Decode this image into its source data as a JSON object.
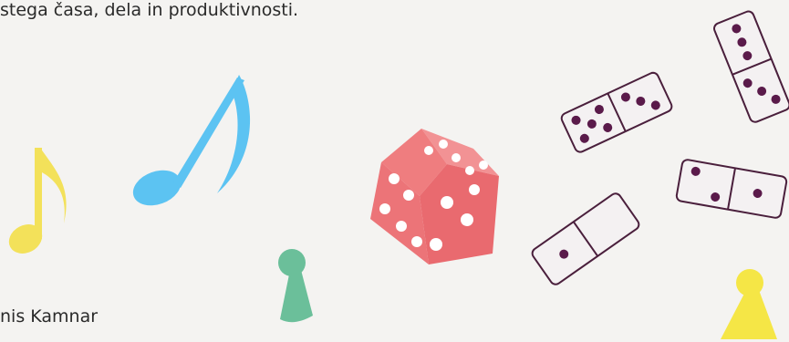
{
  "subtitle_text": "stega časa, dela in produktivnosti.",
  "author_text": "nis Kamnar",
  "colors": {
    "background": "#f4f3f1",
    "note_yellow": "#f3e15a",
    "note_blue": "#5cc3f2",
    "pawn_green": "#6bbf9a",
    "pawn_yellow": "#f5e646",
    "die_face": "#ef7d7f",
    "die_dark": "#d9686c",
    "domino_fill": "#f4f1f2",
    "domino_outline": "#4a1f3c",
    "pip": "#5a1a4a"
  },
  "icons": [
    "music-note-icon",
    "pawn-icon",
    "die-icon",
    "domino-icon"
  ]
}
